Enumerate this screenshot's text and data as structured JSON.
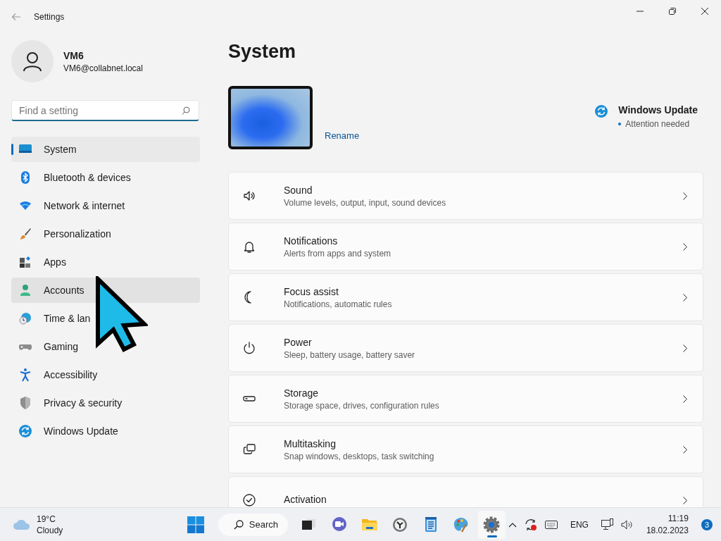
{
  "window": {
    "title": "Settings"
  },
  "profile": {
    "name": "VM6",
    "email": "VM6@collabnet.local"
  },
  "search": {
    "placeholder": "Find a setting"
  },
  "nav": [
    {
      "label": "System",
      "kind": "system",
      "selected": true,
      "hovered": false
    },
    {
      "label": "Bluetooth & devices",
      "kind": "bluetooth",
      "selected": false,
      "hovered": false
    },
    {
      "label": "Network & internet",
      "kind": "network",
      "selected": false,
      "hovered": false
    },
    {
      "label": "Personalization",
      "kind": "personalization",
      "selected": false,
      "hovered": false
    },
    {
      "label": "Apps",
      "kind": "apps",
      "selected": false,
      "hovered": false
    },
    {
      "label": "Accounts",
      "kind": "accounts",
      "selected": false,
      "hovered": true
    },
    {
      "label": "Time & lan",
      "kind": "time",
      "selected": false,
      "hovered": false
    },
    {
      "label": "Gaming",
      "kind": "gaming",
      "selected": false,
      "hovered": false
    },
    {
      "label": "Accessibility",
      "kind": "accessibility",
      "selected": false,
      "hovered": false
    },
    {
      "label": "Privacy & security",
      "kind": "privacy",
      "selected": false,
      "hovered": false
    },
    {
      "label": "Windows Update",
      "kind": "update",
      "selected": false,
      "hovered": false
    }
  ],
  "page": {
    "title": "System",
    "rename": "Rename",
    "update": {
      "title": "Windows Update",
      "status": "Attention needed"
    }
  },
  "cards": [
    {
      "kind": "sound",
      "title": "Sound",
      "subtitle": "Volume levels, output, input, sound devices"
    },
    {
      "kind": "notifications",
      "title": "Notifications",
      "subtitle": "Alerts from apps and system"
    },
    {
      "kind": "focus",
      "title": "Focus assist",
      "subtitle": "Notifications, automatic rules"
    },
    {
      "kind": "power",
      "title": "Power",
      "subtitle": "Sleep, battery usage, battery saver"
    },
    {
      "kind": "storage",
      "title": "Storage",
      "subtitle": "Storage space, drives, configuration rules"
    },
    {
      "kind": "multitasking",
      "title": "Multitasking",
      "subtitle": "Snap windows, desktops, task switching"
    },
    {
      "kind": "activation",
      "title": "Activation"
    }
  ],
  "taskbar": {
    "weather": {
      "temp": "19°C",
      "condition": "Cloudy"
    },
    "search": "Search",
    "apps": [
      {
        "kind": "taskview",
        "active": false
      },
      {
        "kind": "chat",
        "active": false
      },
      {
        "kind": "explorer",
        "active": false
      },
      {
        "kind": "clock",
        "active": false
      },
      {
        "kind": "notepad",
        "active": false
      },
      {
        "kind": "paint",
        "active": false
      },
      {
        "kind": "settings",
        "active": true
      }
    ],
    "tray": {
      "language": "ENG",
      "time": "11:19",
      "date": "18.02.2023",
      "badge": "3"
    }
  }
}
